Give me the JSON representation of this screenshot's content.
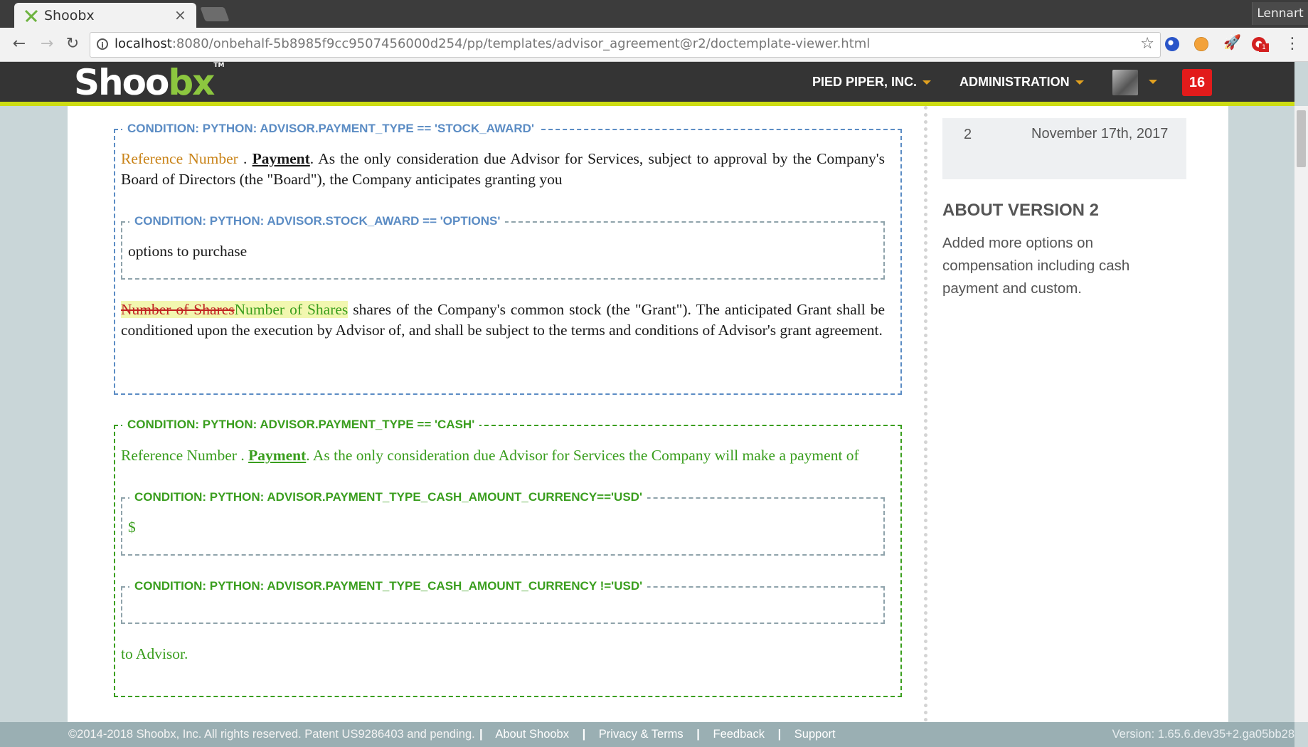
{
  "browser": {
    "tab_title": "Shoobx",
    "tab_close": "×",
    "profile_name": "Lennart",
    "url_host": "localhost",
    "url_rest": ":8080/onbehalf-5b8985f9cc9507456000d254/pp/templates/advisor_agreement@r2/doctemplate-viewer.html",
    "back": "←",
    "forward": "→",
    "reload": "↻",
    "star": "☆",
    "menu": "⋮",
    "ext_badge": "1"
  },
  "header": {
    "logo_main": "Shoo",
    "logo_accent": "bx",
    "logo_tm": "TM",
    "company": "PIED PIPER, INC.",
    "admin": "ADMINISTRATION",
    "notifications": "16"
  },
  "document": {
    "block1": {
      "label": "CONDITION: PYTHON: ADVISOR.PAYMENT_TYPE == 'STOCK_AWARD'",
      "ref": "Reference Number",
      "sep": " . ",
      "heading": "Payment",
      "text": ". As the only consideration due Advisor for Services, subject to approval by the Company's Board of Directors (the \"Board\"), the Company anticipates granting you",
      "inner": {
        "label": "CONDITION: PYTHON: ADVISOR.STOCK_AWARD == 'OPTIONS'",
        "text": "options to purchase"
      },
      "deleted": "Number of Shares",
      "inserted": "Number of Shares",
      "text2": " shares of the Company's common stock (the \"Grant\"). The anticipated Grant shall be conditioned upon the execution by Advisor of, and shall be subject to the terms and conditions of Advisor's grant agreement."
    },
    "block2": {
      "label": "CONDITION: PYTHON: ADVISOR.PAYMENT_TYPE == 'CASH'",
      "ref": "Reference Number",
      "sep": " . ",
      "heading": "Payment",
      "text": ". As the only consideration due Advisor for Services the Company will make a payment of",
      "inner1": {
        "label": "CONDITION: PYTHON: ADVISOR.PAYMENT_TYPE_CASH_AMOUNT_CURRENCY=='USD'",
        "text": "$"
      },
      "inner2": {
        "label": "CONDITION: PYTHON: ADVISOR.PAYMENT_TYPE_CASH_AMOUNT_CURRENCY !='USD'",
        "text": ""
      },
      "closing": "to Advisor."
    }
  },
  "sidebar": {
    "version_number": "2",
    "version_date": "November 17th, 2017",
    "about_title": "ABOUT VERSION 2",
    "about_text": "Added more options on compensation including cash payment and custom."
  },
  "footer": {
    "copyright": "©2014-2018 Shoobx, Inc. All rights reserved. Patent US9286403 and pending.",
    "sep": "|",
    "links": [
      "About Shoobx",
      "Privacy & Terms",
      "Feedback",
      "Support"
    ],
    "version": "Version: 1.65.6.dev35+2.ga05bb28"
  },
  "colors": {
    "brand_green": "#8cc63f",
    "header_bar": "#343434",
    "accent_line": "#cddc13",
    "notification": "#e21b1b",
    "condition_blue": "#5b8cc4",
    "condition_green": "#3a9e1e",
    "reference_orange": "#c9841a",
    "deleted_red": "#c02020"
  }
}
